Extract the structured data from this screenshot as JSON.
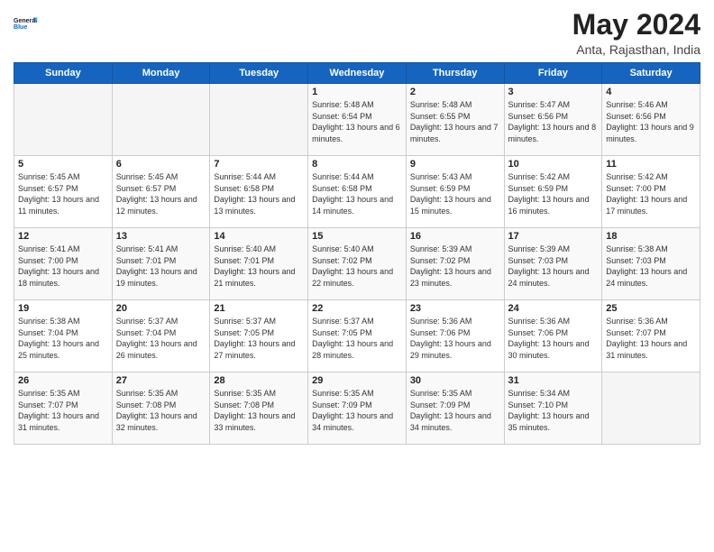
{
  "header": {
    "logo_line1": "General",
    "logo_line2": "Blue",
    "month_title": "May 2024",
    "location": "Anta, Rajasthan, India"
  },
  "weekdays": [
    "Sunday",
    "Monday",
    "Tuesday",
    "Wednesday",
    "Thursday",
    "Friday",
    "Saturday"
  ],
  "weeks": [
    [
      {
        "day": "",
        "sunrise": "",
        "sunset": "",
        "daylight": ""
      },
      {
        "day": "",
        "sunrise": "",
        "sunset": "",
        "daylight": ""
      },
      {
        "day": "",
        "sunrise": "",
        "sunset": "",
        "daylight": ""
      },
      {
        "day": "1",
        "sunrise": "Sunrise: 5:48 AM",
        "sunset": "Sunset: 6:54 PM",
        "daylight": "Daylight: 13 hours and 6 minutes."
      },
      {
        "day": "2",
        "sunrise": "Sunrise: 5:48 AM",
        "sunset": "Sunset: 6:55 PM",
        "daylight": "Daylight: 13 hours and 7 minutes."
      },
      {
        "day": "3",
        "sunrise": "Sunrise: 5:47 AM",
        "sunset": "Sunset: 6:56 PM",
        "daylight": "Daylight: 13 hours and 8 minutes."
      },
      {
        "day": "4",
        "sunrise": "Sunrise: 5:46 AM",
        "sunset": "Sunset: 6:56 PM",
        "daylight": "Daylight: 13 hours and 9 minutes."
      }
    ],
    [
      {
        "day": "5",
        "sunrise": "Sunrise: 5:45 AM",
        "sunset": "Sunset: 6:57 PM",
        "daylight": "Daylight: 13 hours and 11 minutes."
      },
      {
        "day": "6",
        "sunrise": "Sunrise: 5:45 AM",
        "sunset": "Sunset: 6:57 PM",
        "daylight": "Daylight: 13 hours and 12 minutes."
      },
      {
        "day": "7",
        "sunrise": "Sunrise: 5:44 AM",
        "sunset": "Sunset: 6:58 PM",
        "daylight": "Daylight: 13 hours and 13 minutes."
      },
      {
        "day": "8",
        "sunrise": "Sunrise: 5:44 AM",
        "sunset": "Sunset: 6:58 PM",
        "daylight": "Daylight: 13 hours and 14 minutes."
      },
      {
        "day": "9",
        "sunrise": "Sunrise: 5:43 AM",
        "sunset": "Sunset: 6:59 PM",
        "daylight": "Daylight: 13 hours and 15 minutes."
      },
      {
        "day": "10",
        "sunrise": "Sunrise: 5:42 AM",
        "sunset": "Sunset: 6:59 PM",
        "daylight": "Daylight: 13 hours and 16 minutes."
      },
      {
        "day": "11",
        "sunrise": "Sunrise: 5:42 AM",
        "sunset": "Sunset: 7:00 PM",
        "daylight": "Daylight: 13 hours and 17 minutes."
      }
    ],
    [
      {
        "day": "12",
        "sunrise": "Sunrise: 5:41 AM",
        "sunset": "Sunset: 7:00 PM",
        "daylight": "Daylight: 13 hours and 18 minutes."
      },
      {
        "day": "13",
        "sunrise": "Sunrise: 5:41 AM",
        "sunset": "Sunset: 7:01 PM",
        "daylight": "Daylight: 13 hours and 19 minutes."
      },
      {
        "day": "14",
        "sunrise": "Sunrise: 5:40 AM",
        "sunset": "Sunset: 7:01 PM",
        "daylight": "Daylight: 13 hours and 21 minutes."
      },
      {
        "day": "15",
        "sunrise": "Sunrise: 5:40 AM",
        "sunset": "Sunset: 7:02 PM",
        "daylight": "Daylight: 13 hours and 22 minutes."
      },
      {
        "day": "16",
        "sunrise": "Sunrise: 5:39 AM",
        "sunset": "Sunset: 7:02 PM",
        "daylight": "Daylight: 13 hours and 23 minutes."
      },
      {
        "day": "17",
        "sunrise": "Sunrise: 5:39 AM",
        "sunset": "Sunset: 7:03 PM",
        "daylight": "Daylight: 13 hours and 24 minutes."
      },
      {
        "day": "18",
        "sunrise": "Sunrise: 5:38 AM",
        "sunset": "Sunset: 7:03 PM",
        "daylight": "Daylight: 13 hours and 24 minutes."
      }
    ],
    [
      {
        "day": "19",
        "sunrise": "Sunrise: 5:38 AM",
        "sunset": "Sunset: 7:04 PM",
        "daylight": "Daylight: 13 hours and 25 minutes."
      },
      {
        "day": "20",
        "sunrise": "Sunrise: 5:37 AM",
        "sunset": "Sunset: 7:04 PM",
        "daylight": "Daylight: 13 hours and 26 minutes."
      },
      {
        "day": "21",
        "sunrise": "Sunrise: 5:37 AM",
        "sunset": "Sunset: 7:05 PM",
        "daylight": "Daylight: 13 hours and 27 minutes."
      },
      {
        "day": "22",
        "sunrise": "Sunrise: 5:37 AM",
        "sunset": "Sunset: 7:05 PM",
        "daylight": "Daylight: 13 hours and 28 minutes."
      },
      {
        "day": "23",
        "sunrise": "Sunrise: 5:36 AM",
        "sunset": "Sunset: 7:06 PM",
        "daylight": "Daylight: 13 hours and 29 minutes."
      },
      {
        "day": "24",
        "sunrise": "Sunrise: 5:36 AM",
        "sunset": "Sunset: 7:06 PM",
        "daylight": "Daylight: 13 hours and 30 minutes."
      },
      {
        "day": "25",
        "sunrise": "Sunrise: 5:36 AM",
        "sunset": "Sunset: 7:07 PM",
        "daylight": "Daylight: 13 hours and 31 minutes."
      }
    ],
    [
      {
        "day": "26",
        "sunrise": "Sunrise: 5:35 AM",
        "sunset": "Sunset: 7:07 PM",
        "daylight": "Daylight: 13 hours and 31 minutes."
      },
      {
        "day": "27",
        "sunrise": "Sunrise: 5:35 AM",
        "sunset": "Sunset: 7:08 PM",
        "daylight": "Daylight: 13 hours and 32 minutes."
      },
      {
        "day": "28",
        "sunrise": "Sunrise: 5:35 AM",
        "sunset": "Sunset: 7:08 PM",
        "daylight": "Daylight: 13 hours and 33 minutes."
      },
      {
        "day": "29",
        "sunrise": "Sunrise: 5:35 AM",
        "sunset": "Sunset: 7:09 PM",
        "daylight": "Daylight: 13 hours and 34 minutes."
      },
      {
        "day": "30",
        "sunrise": "Sunrise: 5:35 AM",
        "sunset": "Sunset: 7:09 PM",
        "daylight": "Daylight: 13 hours and 34 minutes."
      },
      {
        "day": "31",
        "sunrise": "Sunrise: 5:34 AM",
        "sunset": "Sunset: 7:10 PM",
        "daylight": "Daylight: 13 hours and 35 minutes."
      },
      {
        "day": "",
        "sunrise": "",
        "sunset": "",
        "daylight": ""
      }
    ]
  ]
}
